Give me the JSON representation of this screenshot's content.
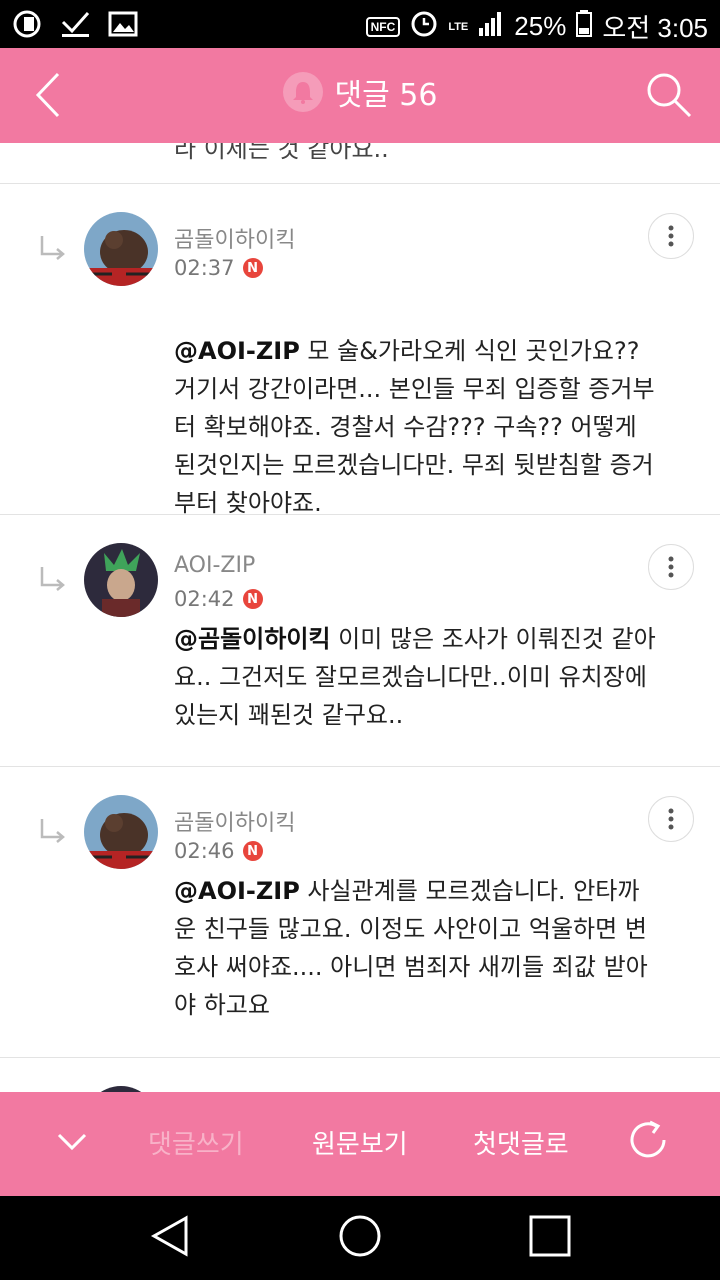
{
  "status_bar": {
    "battery": "25%",
    "time": "오전 3:05",
    "nfc": "NFC",
    "lte": "LTE"
  },
  "header": {
    "title": "댓글",
    "count": "56"
  },
  "partial_text": "라 이제는 것 같아요..",
  "comments": [
    {
      "author": "곰돌이하이킥",
      "time": "02:37",
      "badge": "N",
      "mention": "@AOI-ZIP",
      "text": " 모 술&가라오케 식인 곳인가요?? 거기서 강간이라면... 본인들 무죄 입증할 증거부터 확보해야죠. 경찰서 수감??? 구속?? 어떻게 된것인지는 모르겠습니다만. 무죄 뒷받침할 증거부터 찾아야죠."
    },
    {
      "author": "AOI-ZIP",
      "time": "02:42",
      "badge": "N",
      "mention": "@곰돌이하이킥",
      "text": " 이미 많은 조사가 이뤄진것 같아요.. 그건저도 잘모르겠습니다만..이미 유치장에 있는지 꽤된것 같구요.."
    },
    {
      "author": "곰돌이하이킥",
      "time": "02:46",
      "badge": "N",
      "mention": "@AOI-ZIP",
      "text": " 사실관계를 모르겠습니다. 안타까운 친구들 많고요. 이정도 사안이고 억울하면 변호사 써야죠.... 아니면 범죄자 새끼들 죄값 받아야 하고요"
    }
  ],
  "bottom_bar": {
    "write": "댓글쓰기",
    "original": "원문보기",
    "first": "첫댓글로"
  },
  "colors": {
    "accent": "#f279a1",
    "badge": "#e8453c"
  },
  "icons": [
    "back-arrow-icon",
    "bell-icon",
    "search-icon",
    "reply-arrow-icon",
    "more-icon",
    "chevron-down-icon",
    "refresh-icon",
    "nav-back-icon",
    "nav-home-icon",
    "nav-recents-icon"
  ]
}
